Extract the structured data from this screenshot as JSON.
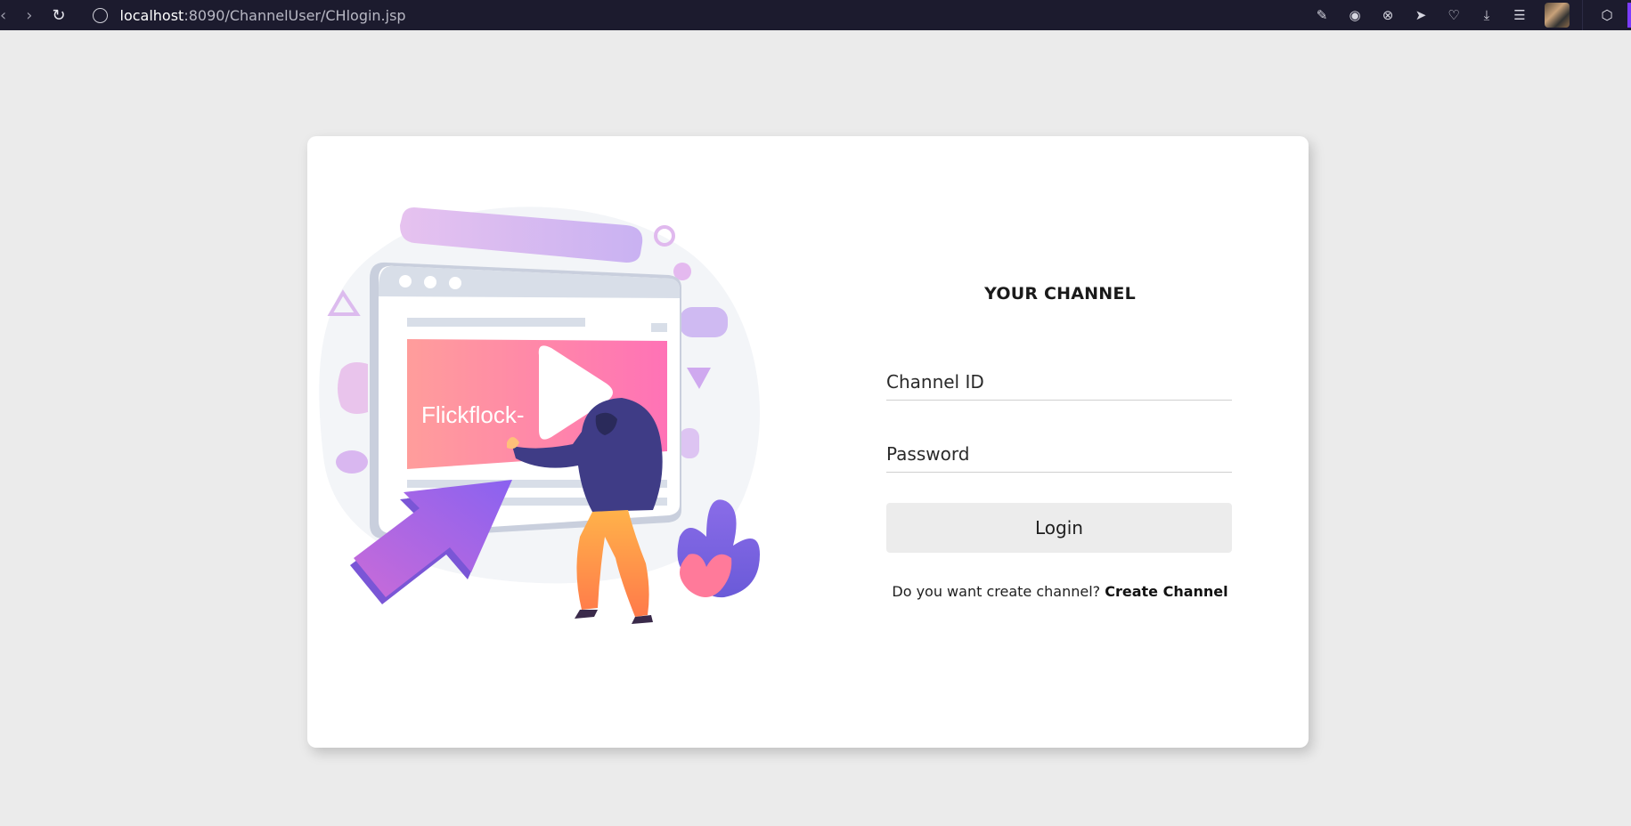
{
  "browser": {
    "host": "localhost",
    "path": ":8090/ChannelUser/CHlogin.jsp"
  },
  "illustration": {
    "video_text": "Flickflock-"
  },
  "form": {
    "title": "YOUR CHANNEL",
    "channel_id_placeholder": "Channel ID",
    "password_placeholder": "Password",
    "login_label": "Login",
    "signup_prompt": "Do you want create channel?",
    "signup_link": "Create Channel"
  },
  "colors": {
    "page_bg": "#ebebeb",
    "chrome_bg": "#1c1b2e",
    "accent": "#7b3cff",
    "video_pink": "#ff6fb1",
    "button_bg": "#ececec"
  }
}
